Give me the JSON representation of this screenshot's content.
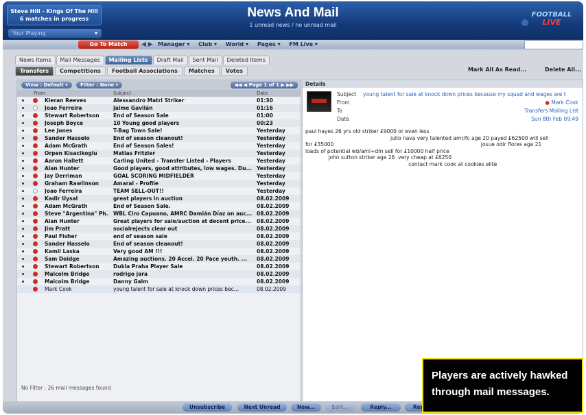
{
  "header": {
    "manager_line1": "Steve Hill - Kings Of The Hill",
    "manager_line2": "6 matches in progress",
    "title": "News And Mail",
    "subtitle": "1 unread news / no unread mail",
    "playing_label": "Your Playing",
    "logo_line1": "FOOTBALL",
    "logo_line2": "LIVE"
  },
  "navbar": {
    "go_to_match": "Go To Match",
    "items": [
      "Manager ▾",
      "Club ▾",
      "World ▾",
      "Pages ▾",
      "FM Live ▾"
    ]
  },
  "tabs": [
    "News Items",
    "Mail Messages",
    "Mailing Lists",
    "Draft Mail",
    "Sent Mail",
    "Deleted Items"
  ],
  "subtabs": [
    "Transfers",
    "Competitions",
    "Football Associations",
    "Matches",
    "Votes"
  ],
  "actions": {
    "mark_all": "Mark All As Read...",
    "delete_all": "Delete All..."
  },
  "list": {
    "view_label": "View : Default ▾",
    "filter_label": "Filter : None ▾",
    "pager": "Page 1 of 1",
    "columns": {
      "from": "From",
      "subject": "Subject",
      "date": "Date"
    },
    "rows": [
      {
        "from": "Kieran Reeves",
        "subject": "Alessandro Matri Striker",
        "date": "01:30"
      },
      {
        "from": "Joao Ferreira",
        "subject": "Jaime Gavilán",
        "date": "01:16"
      },
      {
        "from": "Stewart Robertson",
        "subject": "End of Season Sale",
        "date": "01:00"
      },
      {
        "from": "Joseph Boyce",
        "subject": "10 Young good players",
        "date": "00:23"
      },
      {
        "from": "Lee Jones",
        "subject": "T-Bag Town Sale!",
        "date": "Yesterday"
      },
      {
        "from": "Sander Hasselo",
        "subject": "End of season cleanout!",
        "date": "Yesterday"
      },
      {
        "from": "Adam McGrath",
        "subject": "End of Season Sales!",
        "date": "Yesterday"
      },
      {
        "from": "Orpen Kisacikoglu",
        "subject": "Matias Fritzler",
        "date": "Yesterday"
      },
      {
        "from": "Aaron Hallett",
        "subject": "Carling United - Transfer Listed - Players",
        "date": "Yesterday"
      },
      {
        "from": "Alan Hunter",
        "subject": "Good players, good attributes, low wages. Du...",
        "date": "Yesterday"
      },
      {
        "from": "Jay Derriman",
        "subject": "GOAL SCORING MIDFIELDER",
        "date": "Yesterday"
      },
      {
        "from": "Graham Rawlinson",
        "subject": "Amaral - Profile",
        "date": "Yesterday"
      },
      {
        "from": "Joao Ferreira",
        "subject": "TEAM SELL-OUT!!",
        "date": "Yesterday"
      },
      {
        "from": "Kadir Uysal",
        "subject": "great players in auction",
        "date": "08.02.2009"
      },
      {
        "from": "Adam McGrath",
        "subject": "End of Season Sale.",
        "date": "08.02.2009"
      },
      {
        "from": "Steve \"Argentina\" Ph...",
        "subject": "WBL Ciro Capuano, AMRC Damián Díaz on auc...",
        "date": "08.02.2009"
      },
      {
        "from": "Alan Hunter",
        "subject": "Great players for sale/auction at decent price...",
        "date": "08.02.2009"
      },
      {
        "from": "Jim Pratt",
        "subject": "socialrejects clear out",
        "date": "08.02.2009"
      },
      {
        "from": "Paul Fisher",
        "subject": "end of season sale",
        "date": "08.02.2009"
      },
      {
        "from": "Sander Hasselo",
        "subject": "End of season cleanout!",
        "date": "08.02.2009"
      },
      {
        "from": "Kamil Laska",
        "subject": "Very good AM !!!",
        "date": "08.02.2009"
      },
      {
        "from": "Sam Doidge",
        "subject": "Amazing auctions. 20 Accel. 20 Pace youth. ...",
        "date": "08.02.2009"
      },
      {
        "from": "Stewart Robertson",
        "subject": "Dukla Praha Player Sale",
        "date": "08.02.2009"
      },
      {
        "from": "Malcolm Bridge",
        "subject": "rodrigo jara",
        "date": "08.02.2009"
      },
      {
        "from": "Malcolm Bridge",
        "subject": "Danny Galm",
        "date": "08.02.2009"
      },
      {
        "from": "Mark Cook",
        "subject": "young talent for sale at knock down prices bec...",
        "date": "08.02.2009"
      }
    ],
    "footer": "No Filter : 26 mail messages found"
  },
  "details": {
    "heading": "Details",
    "subject_label": "Subject",
    "subject": "young talent for sale at knock down prices because my squad and wages are t",
    "from_label": "From",
    "from": "Mark Cook",
    "to_label": "To",
    "to": "Transfers Mailing List",
    "date_label": "Date",
    "date": "Sun 8th Feb 09:49",
    "body": [
      "paul hayes 26 yrs old striker £9000 or even less",
      "                                                    julio nava very talented amr/fc age 20 payed £62500 will sell",
      "for £35000                                                                                          josue odir flores age 21",
      "loads of potential wb/aml+dm sell for £10000 half price",
      "              john sutton striker age 26  very cheap at £6250",
      "                                                               contact mark cook at cookies elite"
    ]
  },
  "buttons": [
    "Unsubscribe",
    "Next Unread",
    "New...",
    "Edit...",
    "Reply...",
    "Rep"
  ],
  "caption": {
    "line1": "Players are actively hawked",
    "line2": "through mail messages."
  }
}
